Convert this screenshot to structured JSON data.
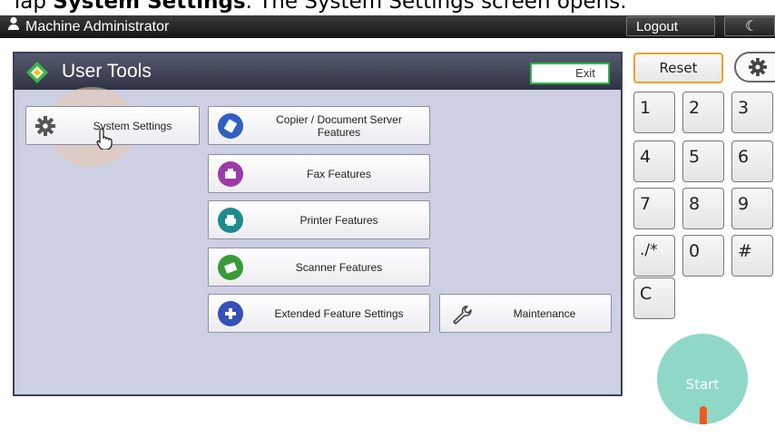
{
  "caption": {
    "prefix": "Tap ",
    "bold": "System Settings",
    "suffix": ". The System Settings screen opens."
  },
  "topbar": {
    "user": "Machine Administrator",
    "logout": "Logout"
  },
  "panel": {
    "title": "User Tools",
    "exit": "Exit",
    "buttons": {
      "system_settings": "System Settings",
      "copier": "Copier / Document Server Features",
      "fax": "Fax Features",
      "printer": "Printer Features",
      "scanner": "Scanner Features",
      "extended": "Extended Feature Settings",
      "maintenance": "Maintenance"
    }
  },
  "keypad": {
    "reset": "Reset",
    "keys": [
      "1",
      "2",
      "3",
      "4",
      "5",
      "6",
      "7",
      "8",
      "9",
      "./*",
      "0",
      "#",
      "C"
    ],
    "start": "Start"
  },
  "colors": {
    "reset_border": "#f0a030",
    "exit_border": "#2eb34a",
    "start": "#8fd8c8",
    "copier_icon": "#2f5fc4",
    "fax_icon": "#9b3aa8",
    "printer_icon": "#1f8a8c",
    "scanner_icon": "#3a9a3a",
    "extended_icon": "#3550b8"
  },
  "icons": {
    "user": "person-icon",
    "moon": "moon-icon",
    "gear": "gear-icon",
    "wrench": "wrench-icon",
    "hand": "pointer-hand-icon",
    "logo": "diamond-logo-icon"
  }
}
